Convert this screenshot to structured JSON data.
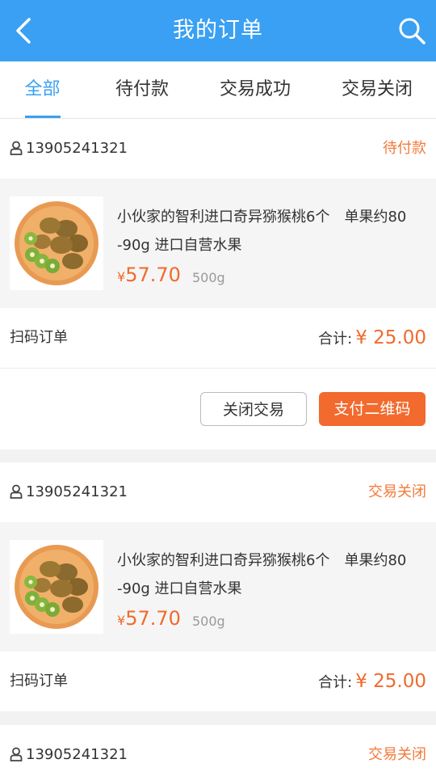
{
  "header": {
    "title": "我的订单"
  },
  "tabs": [
    {
      "label": "全部",
      "active": true
    },
    {
      "label": "待付款",
      "active": false
    },
    {
      "label": "交易成功",
      "active": false
    },
    {
      "label": "交易关闭",
      "active": false
    }
  ],
  "orders": [
    {
      "phone": "13905241321",
      "status": "待付款",
      "product": {
        "name_part1": "小伙家的智利进口奇异猕猴桃6个",
        "name_part2": "单果约80",
        "name_line2": "-90g  进口自营水果",
        "currency": "¥",
        "price": "57.70",
        "weight": "500g"
      },
      "type": "扫码订单",
      "total_label": "合计:",
      "total_amount": "¥ 25.00",
      "actions": {
        "close_label": "关闭交易",
        "pay_label": "支付二维码"
      }
    },
    {
      "phone": "13905241321",
      "status": "交易关闭",
      "product": {
        "name_part1": "小伙家的智利进口奇异猕猴桃6个",
        "name_part2": "单果约80",
        "name_line2": "-90g  进口自营水果",
        "currency": "¥",
        "price": "57.70",
        "weight": "500g"
      },
      "type": "扫码订单",
      "total_label": "合计:",
      "total_amount": "¥ 25.00"
    },
    {
      "phone": "13905241321",
      "status": "交易关闭"
    }
  ],
  "colors": {
    "primary": "#3aa0f3",
    "accent": "#f06a2c",
    "status": "#f27a3a"
  },
  "icons": {
    "back": "chevron-left-icon",
    "search": "search-icon",
    "user": "user-icon",
    "product": "kiwi-fruit-image"
  }
}
